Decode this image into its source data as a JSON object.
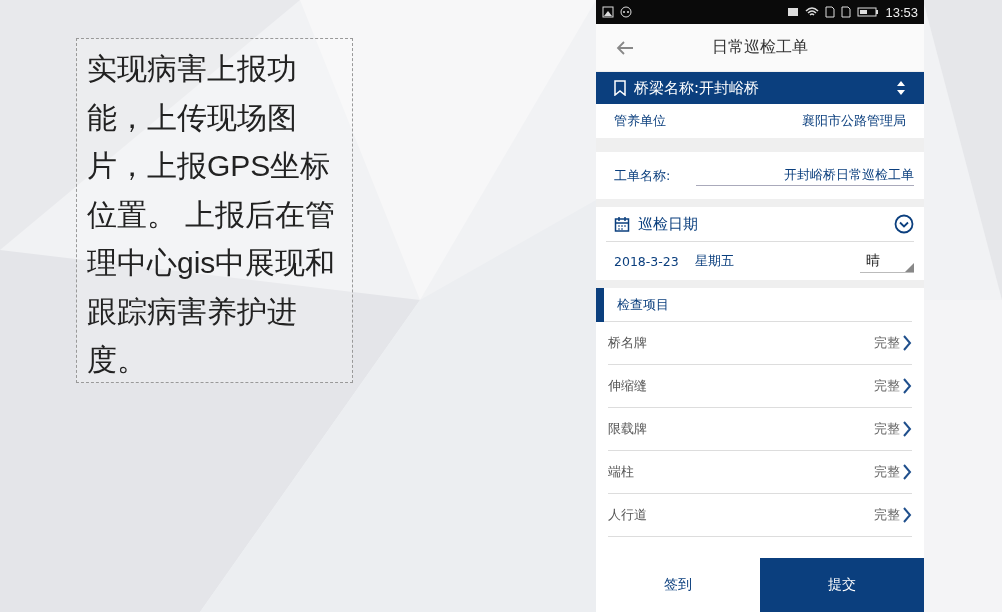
{
  "slide": {
    "description": "实现病害上报功能，上传现场图片，上报GPS坐标位置。 上报后在管理中心gis中展现和跟踪病害养护进度。"
  },
  "status_bar": {
    "time": "13:53"
  },
  "header": {
    "title": "日常巡检工单"
  },
  "bridge_bar": {
    "label": "桥梁名称:开封峪桥"
  },
  "unit": {
    "label": "管养单位",
    "value": "襄阳市公路管理局"
  },
  "order_name": {
    "label": "工单名称:",
    "value": "开封峪桥日常巡检工单"
  },
  "inspection_date": {
    "title": "巡检日期",
    "expanded": true,
    "date": "2018-3-23",
    "weekday": "星期五",
    "weather": "晴"
  },
  "check_items": {
    "title": "检查项目",
    "items": [
      {
        "name": "桥名牌",
        "status": "完整"
      },
      {
        "name": "伸缩缝",
        "status": "完整"
      },
      {
        "name": "限载牌",
        "status": "完整"
      },
      {
        "name": "端柱",
        "status": "完整"
      },
      {
        "name": "人行道",
        "status": "完整"
      }
    ]
  },
  "buttons": [
    {
      "label": "签到",
      "kind": "plain"
    },
    {
      "label": "提交",
      "kind": "primary"
    }
  ]
}
